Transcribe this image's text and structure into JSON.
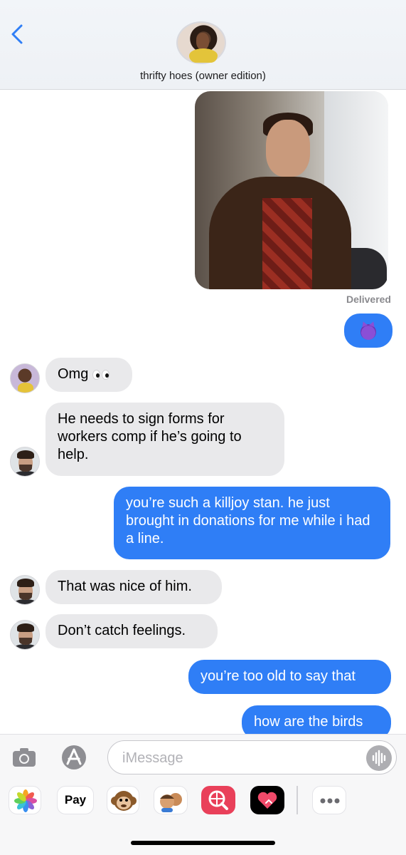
{
  "header": {
    "title": "thrifty hoes (owner edition)"
  },
  "thread": {
    "delivered_label": "Delivered",
    "messages": [
      {
        "text": "Omg"
      },
      {
        "text": "He needs to sign forms for workers comp if he’s going to help."
      },
      {
        "text": "you’re such a killjoy stan. he just brought in donations for me while i had a line."
      },
      {
        "text": "That was nice of him."
      },
      {
        "text": "Don’t catch feelings."
      },
      {
        "text": "you’re too old to say that"
      },
      {
        "text": "how are the birds"
      }
    ]
  },
  "composer": {
    "placeholder": "iMessage",
    "apple_pay_label": "Pay"
  },
  "colors": {
    "sent_bubble": "#2f7ef6",
    "received_bubble": "#e9e9eb",
    "accent": "#2f7ef6"
  }
}
